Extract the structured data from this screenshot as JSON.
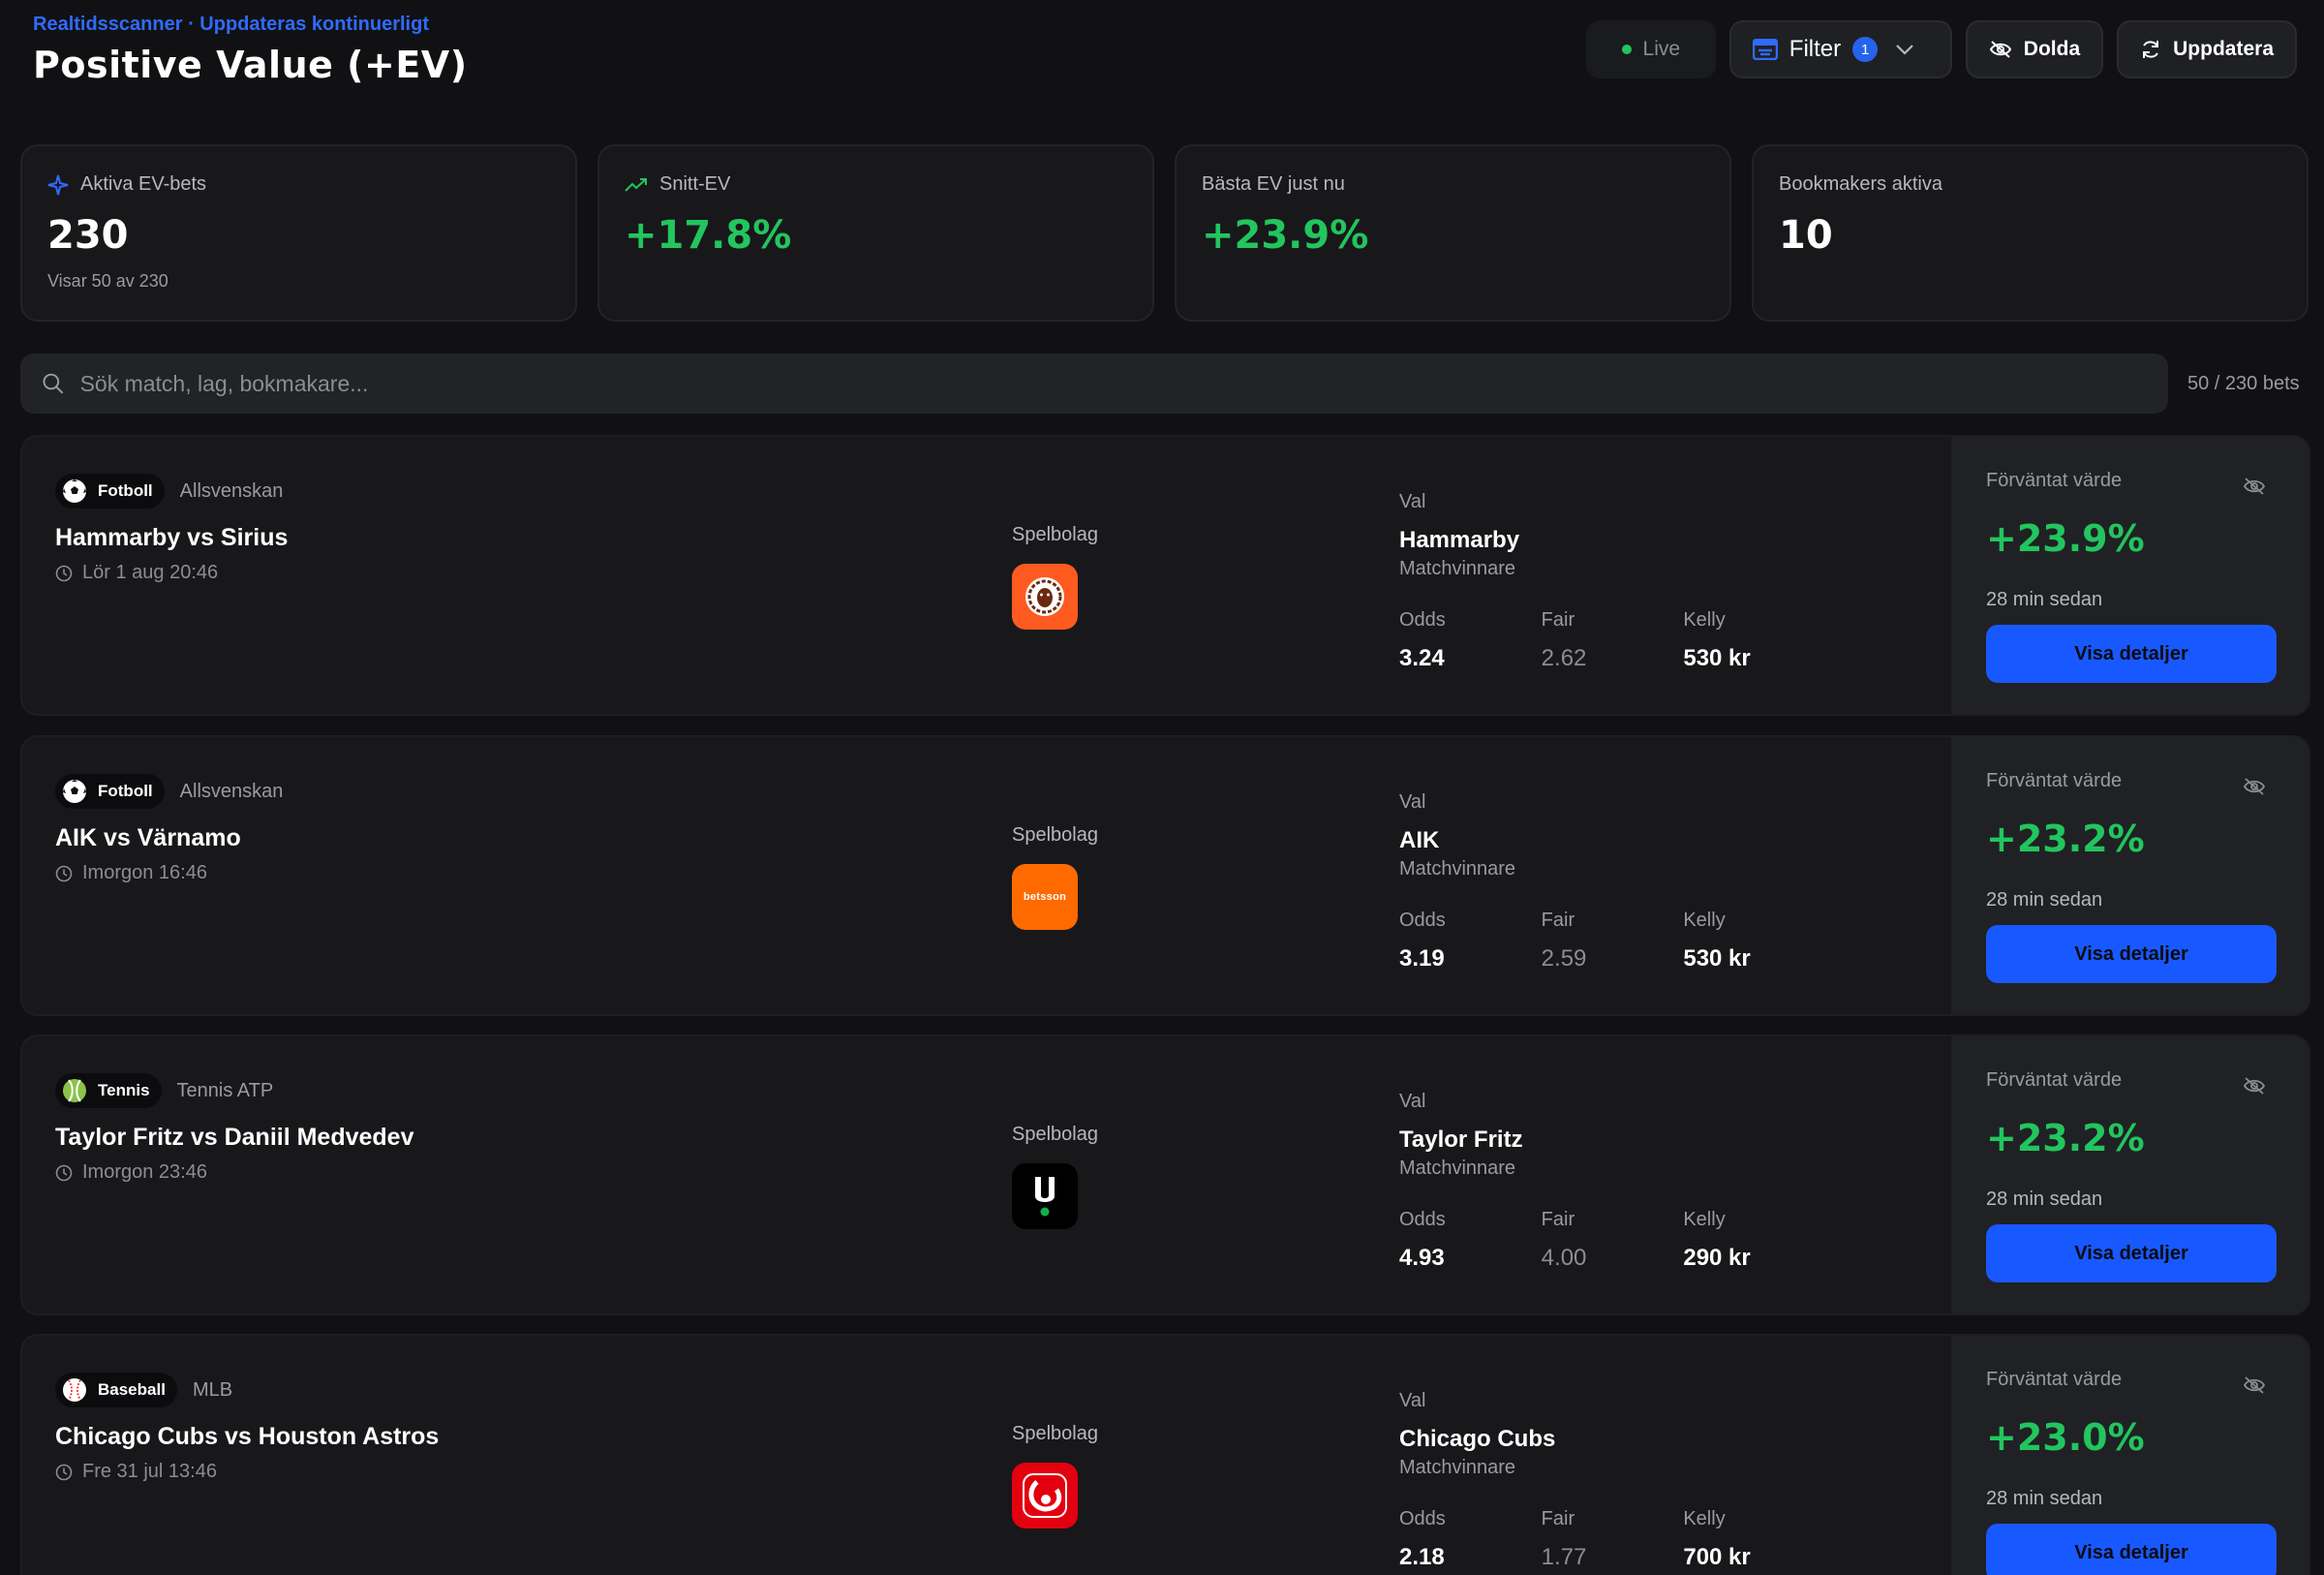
{
  "header": {
    "eyebrow": "Realtidsscanner · Uppdateras kontinuerligt",
    "title": "Positive Value (+EV)"
  },
  "toolbar": {
    "live_label": "Live",
    "filter_label": "Filter",
    "filter_count": "1",
    "hidden_label": "Dolda",
    "refresh_label": "Uppdatera"
  },
  "stats": [
    {
      "label": "Aktiva EV-bets",
      "value": "230",
      "sub": "Visar 50 av 230",
      "icon": "sparkle-icon"
    },
    {
      "label": "Snitt-EV",
      "value": "+17.8%",
      "icon": "trending-up-icon"
    },
    {
      "label": "Bästa EV just nu",
      "value": "+23.9%"
    },
    {
      "label": "Bookmakers aktiva",
      "value": "10"
    }
  ],
  "search": {
    "placeholder": "Sök match, lag, bokmakare...",
    "count": "50 / 230 bets"
  },
  "labels": {
    "bookie": "Spelbolag",
    "pick": "Val",
    "odds": "Odds",
    "fair": "Fair",
    "kelly": "Kelly",
    "ev": "Förväntat värde",
    "details": "Visa detaljer"
  },
  "bets": [
    {
      "sport": "Fotboll",
      "sport_icon": "soccer-ball-icon",
      "league": "Allsvenskan",
      "match": "Hammarby vs Sirius",
      "time": "Lör 1 aug 20:46",
      "bookie_icon": "leovegas-logo",
      "bookie_color": "#ff5a1f",
      "pick": "Hammarby",
      "market": "Matchvinnare",
      "odds": "3.24",
      "fair": "2.62",
      "kelly": "530 kr",
      "ev": "+23.9%",
      "updated": "28 min sedan"
    },
    {
      "sport": "Fotboll",
      "sport_icon": "soccer-ball-icon",
      "league": "Allsvenskan",
      "match": "AIK vs Värnamo",
      "time": "Imorgon 16:46",
      "bookie_icon": "betsson-logo",
      "bookie_color": "#ff6a00",
      "bookie_text": "betsson",
      "pick": "AIK",
      "market": "Matchvinnare",
      "odds": "3.19",
      "fair": "2.59",
      "kelly": "530 kr",
      "ev": "+23.2%",
      "updated": "28 min sedan"
    },
    {
      "sport": "Tennis",
      "sport_icon": "tennis-ball-icon",
      "league": "Tennis ATP",
      "match": "Taylor Fritz vs Daniil Medvedev",
      "time": "Imorgon 23:46",
      "bookie_icon": "unibet-logo",
      "bookie_color": "#000000",
      "pick": "Taylor Fritz",
      "market": "Matchvinnare",
      "odds": "4.93",
      "fair": "4.00",
      "kelly": "290 kr",
      "ev": "+23.2%",
      "updated": "28 min sedan"
    },
    {
      "sport": "Baseball",
      "sport_icon": "baseball-icon",
      "league": "MLB",
      "match": "Chicago Cubs vs Houston Astros",
      "time": "Fre 31 jul 13:46",
      "bookie_icon": "svenska-spel-logo",
      "bookie_color": "#e3000f",
      "pick": "Chicago Cubs",
      "market": "Matchvinnare",
      "odds": "2.18",
      "fair": "1.77",
      "kelly": "700 kr",
      "ev": "+23.0%",
      "updated": "28 min sedan"
    }
  ]
}
